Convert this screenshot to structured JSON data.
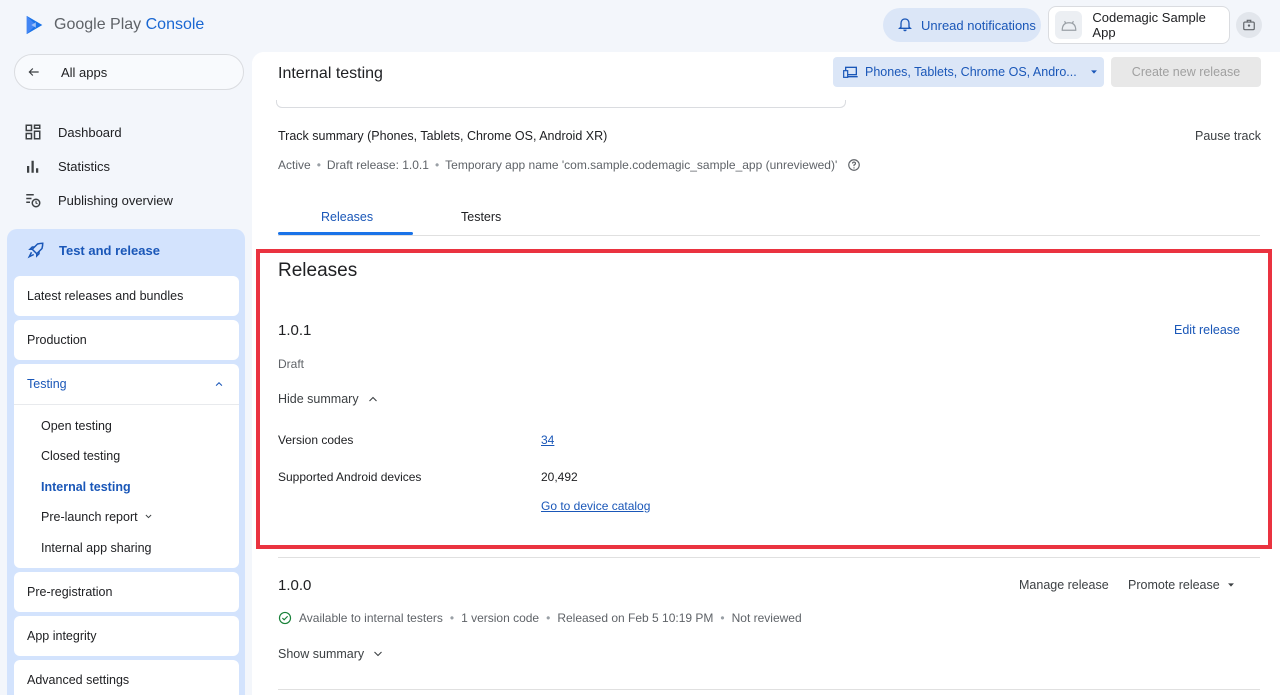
{
  "header": {
    "logo_brand": "Google Play",
    "logo_product": "Console",
    "notifications_label": "Unread notifications",
    "app_name": "Codemagic Sample App"
  },
  "sidebar": {
    "all_apps": "All apps",
    "nav": [
      {
        "label": "Dashboard",
        "icon": "dashboard-icon"
      },
      {
        "label": "Statistics",
        "icon": "bar-chart-icon"
      },
      {
        "label": "Publishing overview",
        "icon": "publishing-clock-icon"
      }
    ],
    "test_and_release": "Test and release",
    "cards": {
      "latest": "Latest releases and bundles",
      "production": "Production",
      "testing": "Testing",
      "pre_registration": "Pre-registration",
      "app_integrity": "App integrity",
      "advanced": "Advanced settings"
    },
    "testing_items": [
      {
        "label": "Open testing"
      },
      {
        "label": "Closed testing"
      },
      {
        "label": "Internal testing",
        "active": true
      },
      {
        "label": "Pre-launch report"
      },
      {
        "label": "Internal app sharing"
      }
    ]
  },
  "main": {
    "title": "Internal testing",
    "device_select": "Phones, Tablets, Chrome OS, Andro...",
    "create_release": "Create new release",
    "track_summary": "Track summary (Phones, Tablets, Chrome OS, Android XR)",
    "pause_track": "Pause track",
    "status": {
      "state": "Active",
      "draft": "Draft release: 1.0.1",
      "temp_name": "Temporary app name 'com.sample.codemagic_sample_app (unreviewed)'"
    },
    "tabs": [
      {
        "label": "Releases"
      },
      {
        "label": "Testers"
      }
    ],
    "releases_title": "Releases",
    "release1": {
      "version": "1.0.1",
      "edit": "Edit release",
      "status": "Draft",
      "hide_summary": "Hide summary",
      "version_codes_label": "Version codes",
      "version_codes_value": "34",
      "devices_label": "Supported Android devices",
      "devices_value": "20,492",
      "catalog_link": "Go to device catalog"
    },
    "release2": {
      "version": "1.0.0",
      "manage": "Manage release",
      "promote": "Promote release",
      "availability": "Available to internal testers",
      "version_count": "1 version code",
      "released_on": "Released on Feb 5 10:19 PM",
      "review": "Not reviewed",
      "show_summary": "Show summary"
    }
  },
  "colors": {
    "accent": "#1a57b8",
    "highlight_border": "#ea3340",
    "active_group_bg": "#d3e3fd"
  }
}
